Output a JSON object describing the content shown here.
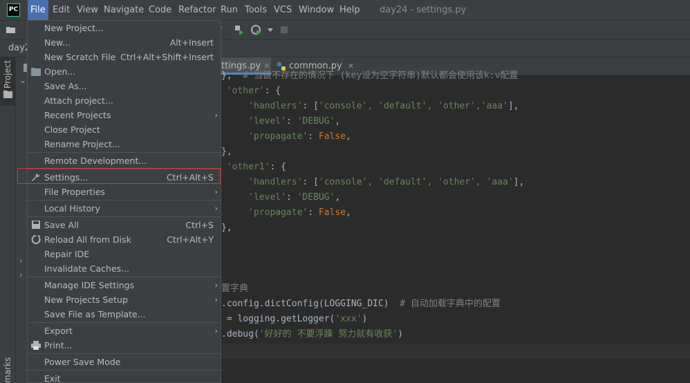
{
  "app": {
    "logo_text": "PC",
    "window_title": "day24 - settings.py"
  },
  "menubar": [
    {
      "label": "File",
      "active": true
    },
    {
      "label": "Edit"
    },
    {
      "label": "View"
    },
    {
      "label": "Navigate"
    },
    {
      "label": "Code"
    },
    {
      "label": "Refactor"
    },
    {
      "label": "Run"
    },
    {
      "label": "Tools"
    },
    {
      "label": "VCS"
    },
    {
      "label": "Window"
    },
    {
      "label": "Help"
    }
  ],
  "breadcrumb": {
    "project": "day2"
  },
  "sidebar": {
    "project_tab": "Project",
    "bookmarks_tab": "marks"
  },
  "tabs": [
    {
      "label": "ttings.py",
      "active": true
    },
    {
      "label": "common.py",
      "active": false
    }
  ],
  "file_menu": {
    "items": [
      {
        "label": "New Project...",
        "shortcut": ""
      },
      {
        "label": "New...",
        "shortcut": "Alt+Insert"
      },
      {
        "label": "New Scratch File",
        "shortcut": "Ctrl+Alt+Shift+Insert"
      },
      {
        "label": "Open...",
        "shortcut": ""
      },
      {
        "label": "Save As...",
        "shortcut": ""
      },
      {
        "label": "Attach project...",
        "shortcut": ""
      },
      {
        "label": "Recent Projects",
        "shortcut": ""
      },
      {
        "label": "Close Project",
        "shortcut": ""
      },
      {
        "label": "Rename Project...",
        "shortcut": ""
      },
      {
        "label": "Remote Development...",
        "shortcut": ""
      },
      {
        "label": "Settings...",
        "shortcut": "Ctrl+Alt+S"
      },
      {
        "label": "File Properties",
        "shortcut": ""
      },
      {
        "label": "Local History",
        "shortcut": ""
      },
      {
        "label": "Save All",
        "shortcut": "Ctrl+S"
      },
      {
        "label": "Reload All from Disk",
        "shortcut": "Ctrl+Alt+Y"
      },
      {
        "label": "Repair IDE",
        "shortcut": ""
      },
      {
        "label": "Invalidate Caches...",
        "shortcut": ""
      },
      {
        "label": "Manage IDE Settings",
        "shortcut": ""
      },
      {
        "label": "New Projects Setup",
        "shortcut": ""
      },
      {
        "label": "Save File as Template...",
        "shortcut": ""
      },
      {
        "label": "Export",
        "shortcut": ""
      },
      {
        "label": "Print...",
        "shortcut": ""
      },
      {
        "label": "Power Save Mode",
        "shortcut": ""
      },
      {
        "label": "Exit",
        "shortcut": ""
      }
    ]
  },
  "editor": {
    "lines": [
      {
        "t1": "},  ",
        "comment": "# 当键不存在的情况下 (key设为空字符串)默认都会使用该k:v配置"
      },
      {
        "key": "'other'",
        "rest": ": {"
      },
      {
        "indent": "    ",
        "key": "'handlers'",
        "rest": ": [",
        "vals": "'console', 'default', 'other','aaa'",
        "end": "],"
      },
      {
        "indent": "    ",
        "key": "'level'",
        "rest": ": ",
        "vals": "'DEBUG'",
        "end": ","
      },
      {
        "indent": "    ",
        "key": "'propagate'",
        "rest": ": ",
        "kw": "False",
        "end": ","
      },
      {
        "plain": "},"
      },
      {
        "key": "'other1'",
        "rest": ": {"
      },
      {
        "indent": "    ",
        "key": "'handlers'",
        "rest": ": [",
        "vals": "'console', 'default', 'other', 'aaa'",
        "end": "],"
      },
      {
        "indent": "    ",
        "key": "'level'",
        "rest": ": ",
        "vals": "'DEBUG'",
        "end": ","
      },
      {
        "indent": "    ",
        "key": "'propagate'",
        "rest": ": ",
        "kw": "False",
        "end": ","
      },
      {
        "plain": "},"
      },
      {
        "plain": ""
      },
      {
        "plain": ""
      },
      {
        "plain": ""
      },
      {
        "plain": "置字典"
      },
      {
        "plain": ".config.dictConfig(LOGGING_DIC)  ",
        "comment": "# 自动加载字典中的配置"
      },
      {
        "plain": " = logging.getLogger(",
        "vals": "'xxx'",
        "end": ")"
      },
      {
        "plain": ".debug(",
        "vals": "'好好的 不要浮躁 努力就有收获'",
        "end": ")"
      }
    ]
  },
  "colors": {
    "accent": "#4b6eaf",
    "highlight_border": "#d9393a",
    "string": "#6a8759",
    "keyword": "#cc7832"
  }
}
